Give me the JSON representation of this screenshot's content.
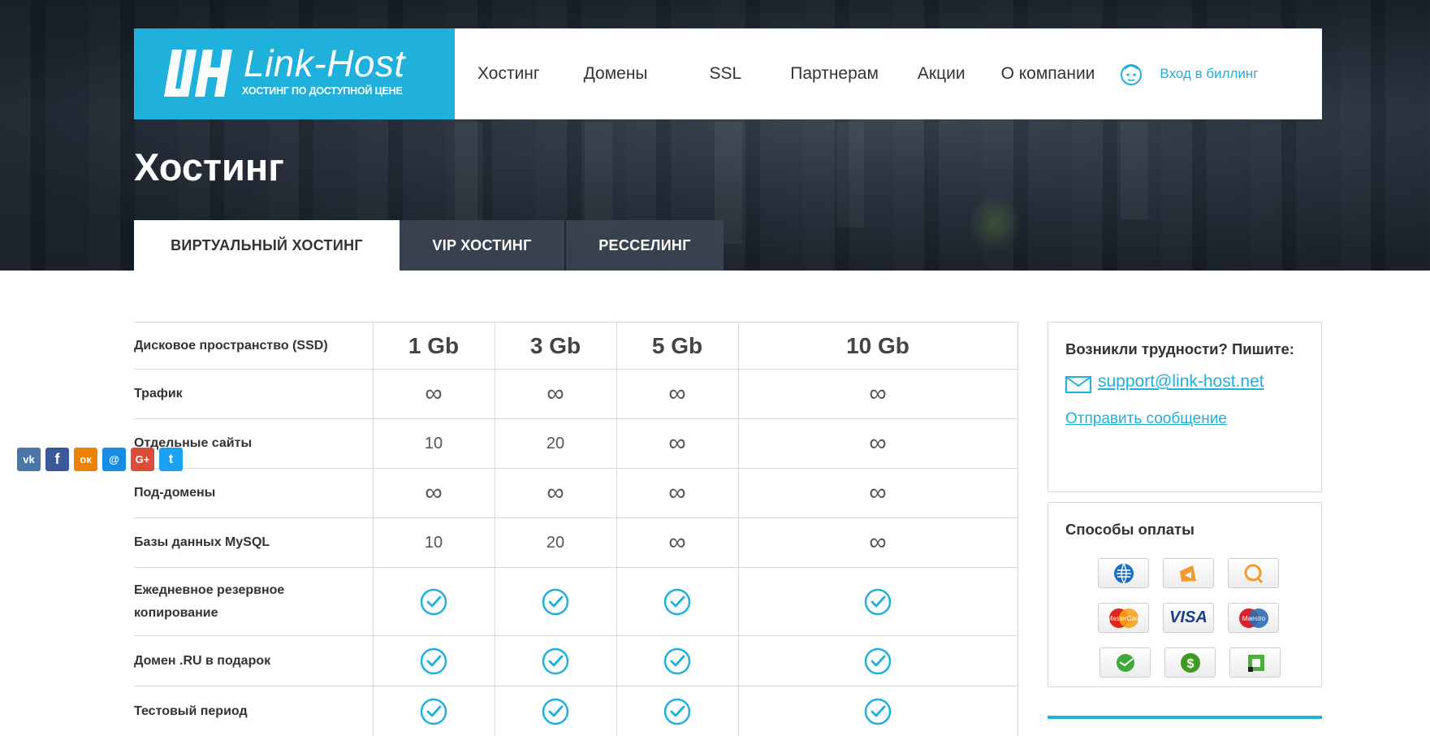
{
  "header": {
    "brand": "Link-Host",
    "tagline": "ХОСТИНГ ПО ДОСТУПНОЙ ЦЕНЕ",
    "nav": [
      "Хостинг",
      "Домены",
      "SSL",
      "Партнерам",
      "Акции",
      "О компании"
    ],
    "billing_label": "Вход в биллинг"
  },
  "page": {
    "title": "Хостинг",
    "tabs": [
      "ВИРТУАЛЬНЫЙ ХОСТИНГ",
      "VIP ХОСТИНГ",
      "РЕССЕЛИНГ"
    ],
    "active_tab": "ВИРТУАЛЬНЫЙ ХОСТИНГ"
  },
  "table": {
    "header_label": "Дисковое пространство (SSD)",
    "plans": [
      "1 Gb",
      "3 Gb",
      "5 Gb",
      "10 Gb"
    ],
    "rows": [
      {
        "label": "Трафик",
        "values": [
          "∞",
          "∞",
          "∞",
          "∞"
        ]
      },
      {
        "label": "Отдельные сайты",
        "values": [
          "10",
          "20",
          "∞",
          "∞"
        ]
      },
      {
        "label": "Под-домены",
        "values": [
          "∞",
          "∞",
          "∞",
          "∞"
        ]
      },
      {
        "label": "Базы данных MySQL",
        "values": [
          "10",
          "20",
          "∞",
          "∞"
        ]
      },
      {
        "label": "Ежедневное резервное копирование",
        "values": [
          "check",
          "check",
          "check",
          "check"
        ]
      },
      {
        "label": "Домен .RU в подарок",
        "values": [
          "check",
          "check",
          "check",
          "check"
        ]
      },
      {
        "label": "Тестовый период",
        "values": [
          "check",
          "check",
          "check",
          "check"
        ]
      }
    ]
  },
  "sidebar": {
    "support_question": "Возникли трудности? Пишите:",
    "support_email": "support@link-host.net",
    "send_message": "Отправить сообщение",
    "social": [
      {
        "icon": "vk-icon",
        "glyph": "vk",
        "color": "#4a76a8"
      },
      {
        "icon": "facebook-icon",
        "glyph": "f",
        "color": "#3b5998"
      },
      {
        "icon": "odnoklassniki-icon",
        "glyph": "ок",
        "color": "#ee8208"
      },
      {
        "icon": "moimir-icon",
        "glyph": "@",
        "color": "#168de2"
      },
      {
        "icon": "google-plus-icon",
        "glyph": "G+",
        "color": "#dd4b39"
      },
      {
        "icon": "twitter-icon",
        "glyph": "t",
        "color": "#1da1f2"
      }
    ],
    "payments_title": "Способы оплаты",
    "payments": [
      {
        "icon": "webmoney-icon"
      },
      {
        "icon": "yandex-money-icon"
      },
      {
        "icon": "qiwi-icon"
      },
      {
        "icon": "mastercard-icon",
        "label": "MasterCard"
      },
      {
        "icon": "visa-icon",
        "label": "VISA"
      },
      {
        "icon": "maestro-icon",
        "label": "Maestro"
      },
      {
        "icon": "sberbank-icon"
      },
      {
        "icon": "money-icon"
      },
      {
        "icon": "privat-icon"
      }
    ]
  },
  "colors": {
    "accent": "#1fb0dc",
    "text": "#333333"
  }
}
